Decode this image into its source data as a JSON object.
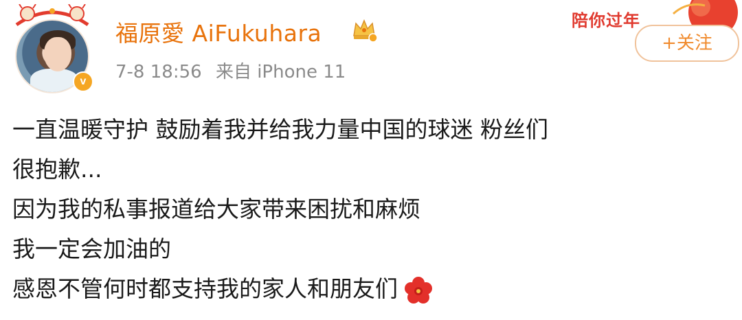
{
  "header": {
    "username": "福原愛 AiFukuhara",
    "timestamp": "7-8 18:56",
    "source": "来自 iPhone 11",
    "verified_mark": "v",
    "follow_label": "+关注",
    "banner_text": "陪你过年"
  },
  "post": {
    "lines": [
      "一直温暖守护 鼓励着我并给我力量中国的球迷 粉丝们",
      "很抱歉...",
      "因为我的私事报道给大家带来困扰和麻烦",
      "我一定会加油的",
      "感恩不管何时都支持我的家人和朋友们"
    ]
  },
  "icons": {
    "crown": "crown-badge-icon",
    "verified": "verified-icon",
    "flower": "red-flower-emoji-icon"
  },
  "colors": {
    "username": "#e8730c",
    "meta": "#8a8a8a",
    "follow_border": "#f0c29a",
    "follow_text": "#f08a2c",
    "verified": "#f5a623",
    "banner": "#e03a2f"
  }
}
